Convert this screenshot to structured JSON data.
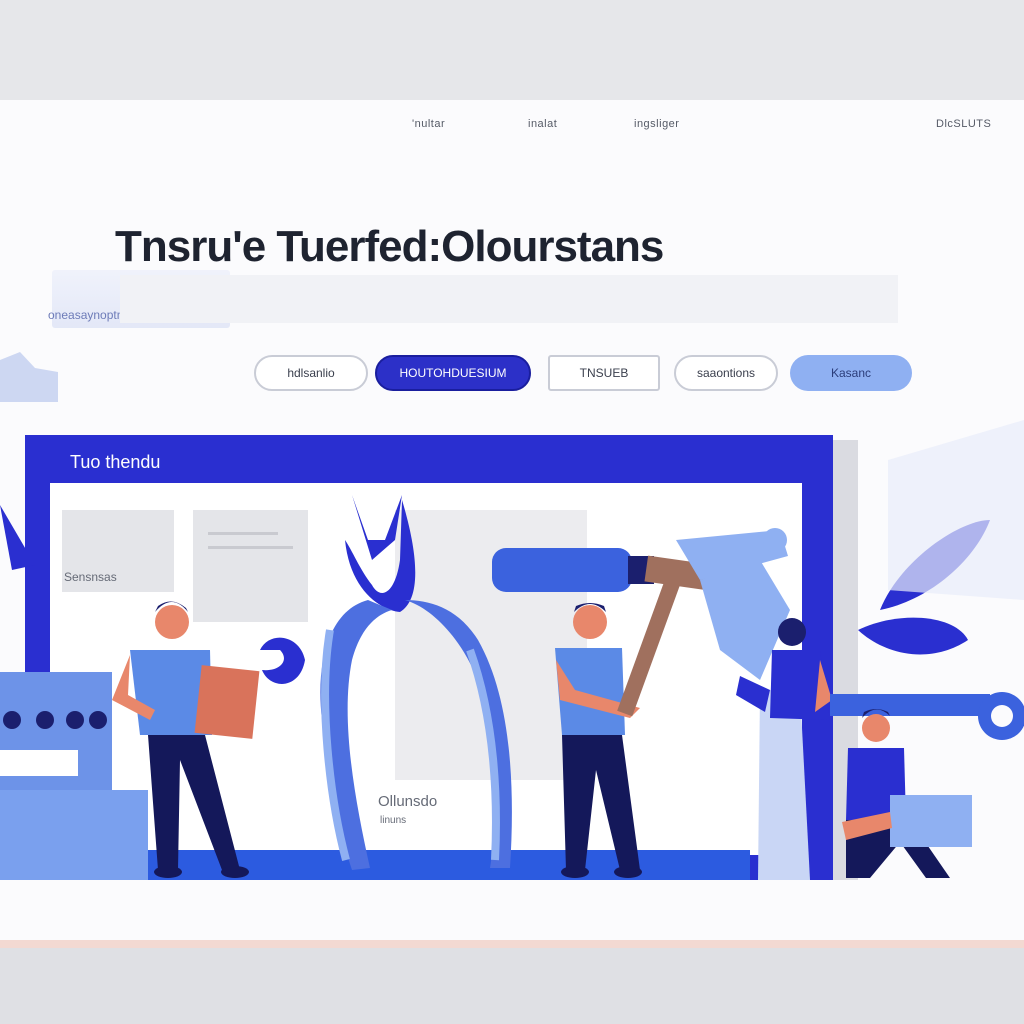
{
  "nav": {
    "items": [
      "'nultar",
      "inalat",
      "ingsliger"
    ],
    "right": "DlcSLUTS"
  },
  "hero": {
    "title": "Tnsru'e Tuerfed:Olourstans"
  },
  "badge": {
    "text": "oneasaynoptndruzt"
  },
  "buttons": [
    {
      "label": "hdlsanlio",
      "style": "outline"
    },
    {
      "label": "HOUTOHDUESIUM",
      "style": "primary"
    },
    {
      "label": "TNSUEB",
      "style": "box"
    },
    {
      "label": "saaontions",
      "style": "outline"
    },
    {
      "label": "Kasanc",
      "style": "light"
    }
  ],
  "browser": {
    "label": "Tuo thendu",
    "card_text": "Sensnsas",
    "center_caption": "Ollunsdo",
    "center_sub": "linuns"
  },
  "colors": {
    "primary": "#2a2fd0",
    "accent_light": "#8fb0f2",
    "floor": "#2c5be0",
    "skin": "#e8876b",
    "hammer_handle": "#a0705e"
  },
  "icons": [
    "pliers-icon",
    "hammer-icon",
    "wrench-icon",
    "leaf-icon",
    "machine-icon",
    "clipboard-icon",
    "laptop-icon"
  ]
}
